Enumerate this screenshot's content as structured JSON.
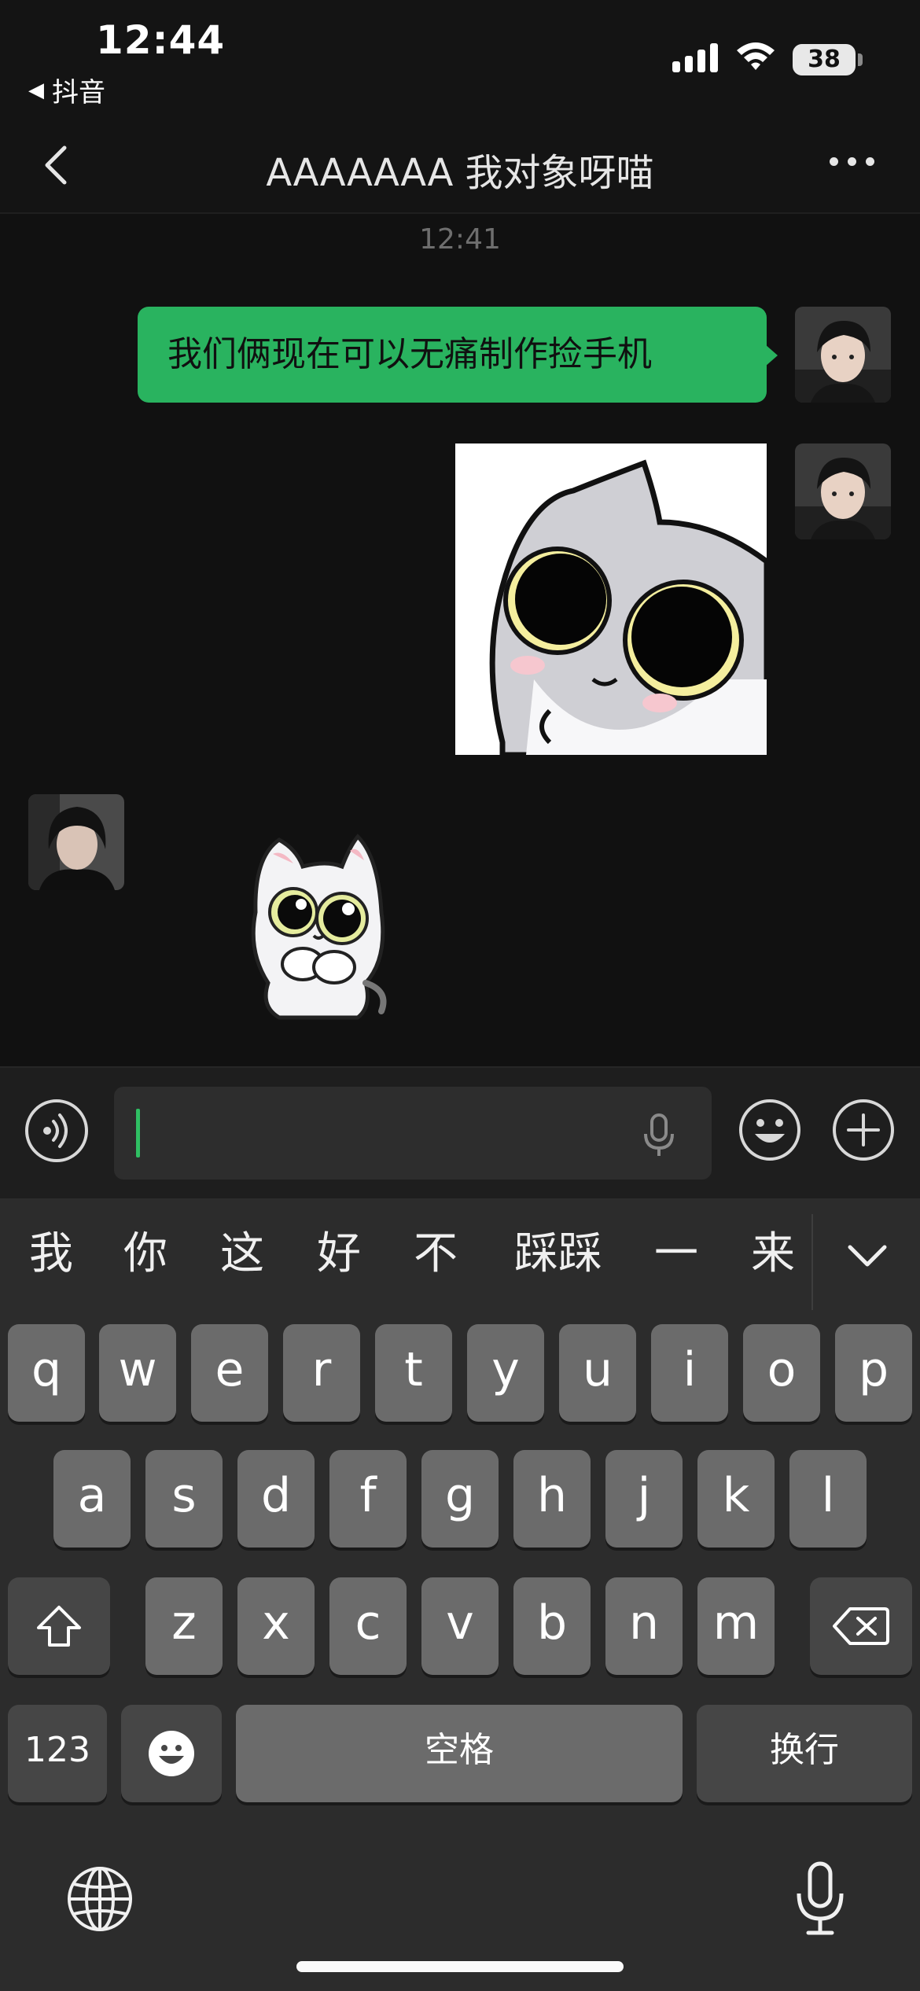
{
  "status": {
    "time": "12:44",
    "back_app": "抖音",
    "battery": "38"
  },
  "nav": {
    "title": "AAAAAAA 我对象呀喵"
  },
  "chat": {
    "timestamp": "12:41",
    "messages": [
      {
        "side": "right",
        "type": "text",
        "text": "我们俩现在可以无痛制作捡手机"
      },
      {
        "side": "right",
        "type": "sticker",
        "sticker": "cat-staring-sticker"
      },
      {
        "side": "left",
        "type": "sticker",
        "sticker": "cat-pleading-sticker"
      }
    ]
  },
  "input": {
    "value": "",
    "icons": [
      "voice-icon",
      "mic-icon",
      "emoji-icon",
      "plus-icon"
    ]
  },
  "keyboard": {
    "candidates": [
      "我",
      "你",
      "这",
      "好",
      "不",
      "踩踩",
      "一",
      "来"
    ],
    "row1": [
      "q",
      "w",
      "e",
      "r",
      "t",
      "y",
      "u",
      "i",
      "o",
      "p"
    ],
    "row2": [
      "a",
      "s",
      "d",
      "f",
      "g",
      "h",
      "j",
      "k",
      "l"
    ],
    "row3": [
      "z",
      "x",
      "c",
      "v",
      "b",
      "n",
      "m"
    ],
    "numbers_label": "123",
    "space_label": "空格",
    "return_label": "换行"
  },
  "colors": {
    "background": "#111111",
    "bubble_green": "#29b35f",
    "key_light": "#6b6b6b",
    "key_dark": "#464646",
    "keyboard_bg": "#2c2c2c"
  }
}
